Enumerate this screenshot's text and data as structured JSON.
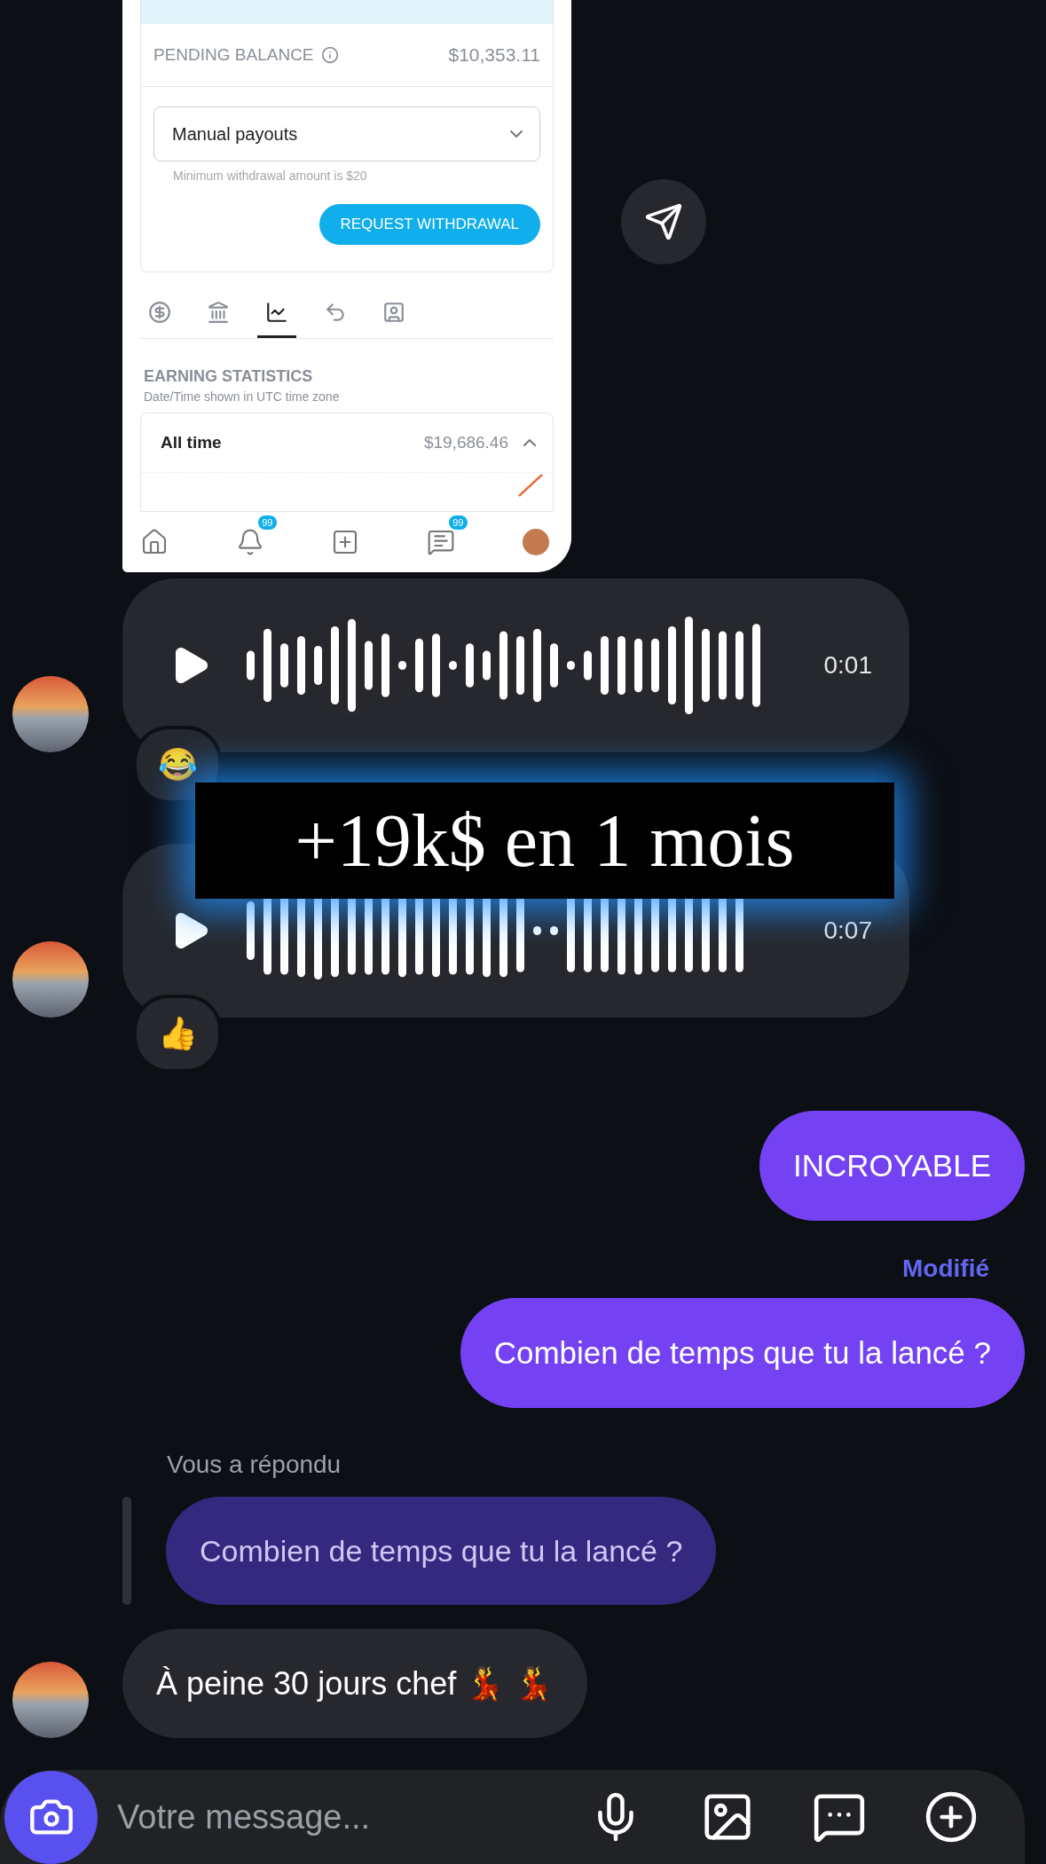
{
  "shared_screenshot": {
    "pending_label": "PENDING BALANCE",
    "pending_value": "$10,353.11",
    "payout_select": {
      "value": "Manual payouts"
    },
    "min_note": "Minimum withdrawal amount is $20",
    "request_button": "REQUEST WITHDRAWAL",
    "tabs": [
      {
        "kind": "dollar",
        "selected": false
      },
      {
        "kind": "bank",
        "selected": false
      },
      {
        "kind": "chart",
        "selected": true
      },
      {
        "kind": "undo",
        "selected": false
      },
      {
        "kind": "contact",
        "selected": false
      }
    ],
    "section_title": "EARNING STATISTICS",
    "section_subtitle": "Date/Time shown in UTC time zone",
    "stat": {
      "period": "All time",
      "amount": "$19,686.46",
      "expanded": true
    },
    "nav": [
      {
        "kind": "home"
      },
      {
        "kind": "bell",
        "badge": "99"
      },
      {
        "kind": "add"
      },
      {
        "kind": "chat",
        "badge": "99"
      },
      {
        "kind": "avatar"
      }
    ]
  },
  "caption": "+19k$ en 1 mois",
  "messages": [
    {
      "kind": "voice",
      "outgoing": false,
      "duration": "0:01",
      "reaction": "😂"
    },
    {
      "kind": "voice",
      "outgoing": false,
      "duration": "0:07",
      "reaction": "👍"
    },
    {
      "kind": "text",
      "outgoing": true,
      "text": "INCROYABLE"
    },
    {
      "kind": "text",
      "outgoing": true,
      "text": "Combien de temps que tu la lancé ?",
      "edited_label": "Modifié"
    },
    {
      "kind": "reply",
      "outgoing": true,
      "label": "Vous a répondu",
      "quote": "Combien de temps que tu la lancé ?"
    },
    {
      "kind": "text",
      "outgoing": false,
      "text": "À peine 30 jours chef 💃 💃"
    }
  ],
  "composer": {
    "placeholder": "Votre message..."
  }
}
